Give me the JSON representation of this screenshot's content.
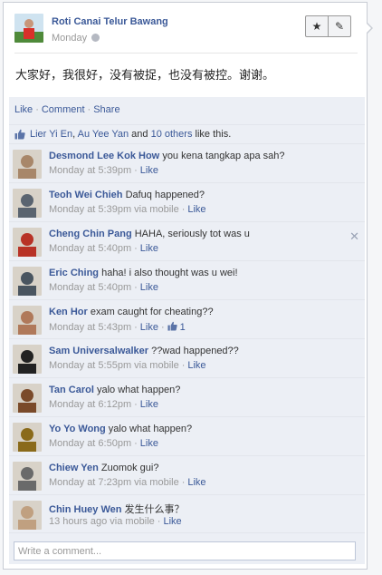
{
  "post": {
    "author": "Roti Canai Telur Bawang",
    "time": "Monday",
    "message": "大家好，我很好，没有被捉，也没有被控。谢谢。"
  },
  "buttons": {
    "star": "★",
    "edit": "✎"
  },
  "actions": {
    "like": "Like",
    "comment": "Comment",
    "share": "Share"
  },
  "likes": {
    "person1": "Lier Yi En",
    "sep": ", ",
    "person2": "Au Yee Yan",
    "and": " and ",
    "others": "10 others",
    "suffix": " like this."
  },
  "comments": [
    {
      "author": "Desmond Lee Kok How",
      "text": "you kena tangkap apa sah?",
      "time": "Monday at 5:39pm",
      "via": "",
      "like": "Like",
      "likes": "",
      "avatar_color": "#a8876a"
    },
    {
      "author": "Teoh Wei Chieh",
      "text": "Dafuq happened?",
      "time": "Monday at 5:39pm",
      "via": " via mobile",
      "like": "Like",
      "likes": "",
      "avatar_color": "#5a6470"
    },
    {
      "author": "Cheng Chin Pang",
      "text": "HAHA, seriously tot was u",
      "time": "Monday at 5:40pm",
      "via": "",
      "like": "Like",
      "likes": "",
      "avatar_color": "#b83226"
    },
    {
      "author": "Eric Ching",
      "text": "haha! i also thought was u wei!",
      "time": "Monday at 5:40pm",
      "via": "",
      "like": "Like",
      "likes": "",
      "avatar_color": "#4a5560"
    },
    {
      "author": "Ken Hor",
      "text": "exam caught for cheating??",
      "time": "Monday at 5:43pm",
      "via": "",
      "like": "Like",
      "likes": "1",
      "avatar_color": "#b0795a"
    },
    {
      "author": "Sam Universalwalker",
      "text": "??wad happened??",
      "time": "Monday at 5:55pm",
      "via": " via mobile",
      "like": "Like",
      "likes": "",
      "avatar_color": "#222222"
    },
    {
      "author": "Tan Carol",
      "text": "yalo what happen?",
      "time": "Monday at 6:12pm",
      "via": "",
      "like": "Like",
      "likes": "",
      "avatar_color": "#7a4a2a"
    },
    {
      "author": "Yo Yo Wong",
      "text": "yalo what happen?",
      "time": "Monday at 6:50pm",
      "via": "",
      "like": "Like",
      "likes": "",
      "avatar_color": "#8a6a1a"
    },
    {
      "author": "Chiew Yen",
      "text": "Zuomok gui?",
      "time": "Monday at 7:23pm",
      "via": " via mobile",
      "like": "Like",
      "likes": "",
      "avatar_color": "#6a6a6a"
    },
    {
      "author": "Chin Huey Wen",
      "text": "发生什么事？",
      "time": "13 hours ago",
      "via": " via mobile",
      "like": "Like",
      "likes": "",
      "avatar_color": "#c0a080"
    }
  ],
  "composer": {
    "placeholder": "Write a comment..."
  }
}
